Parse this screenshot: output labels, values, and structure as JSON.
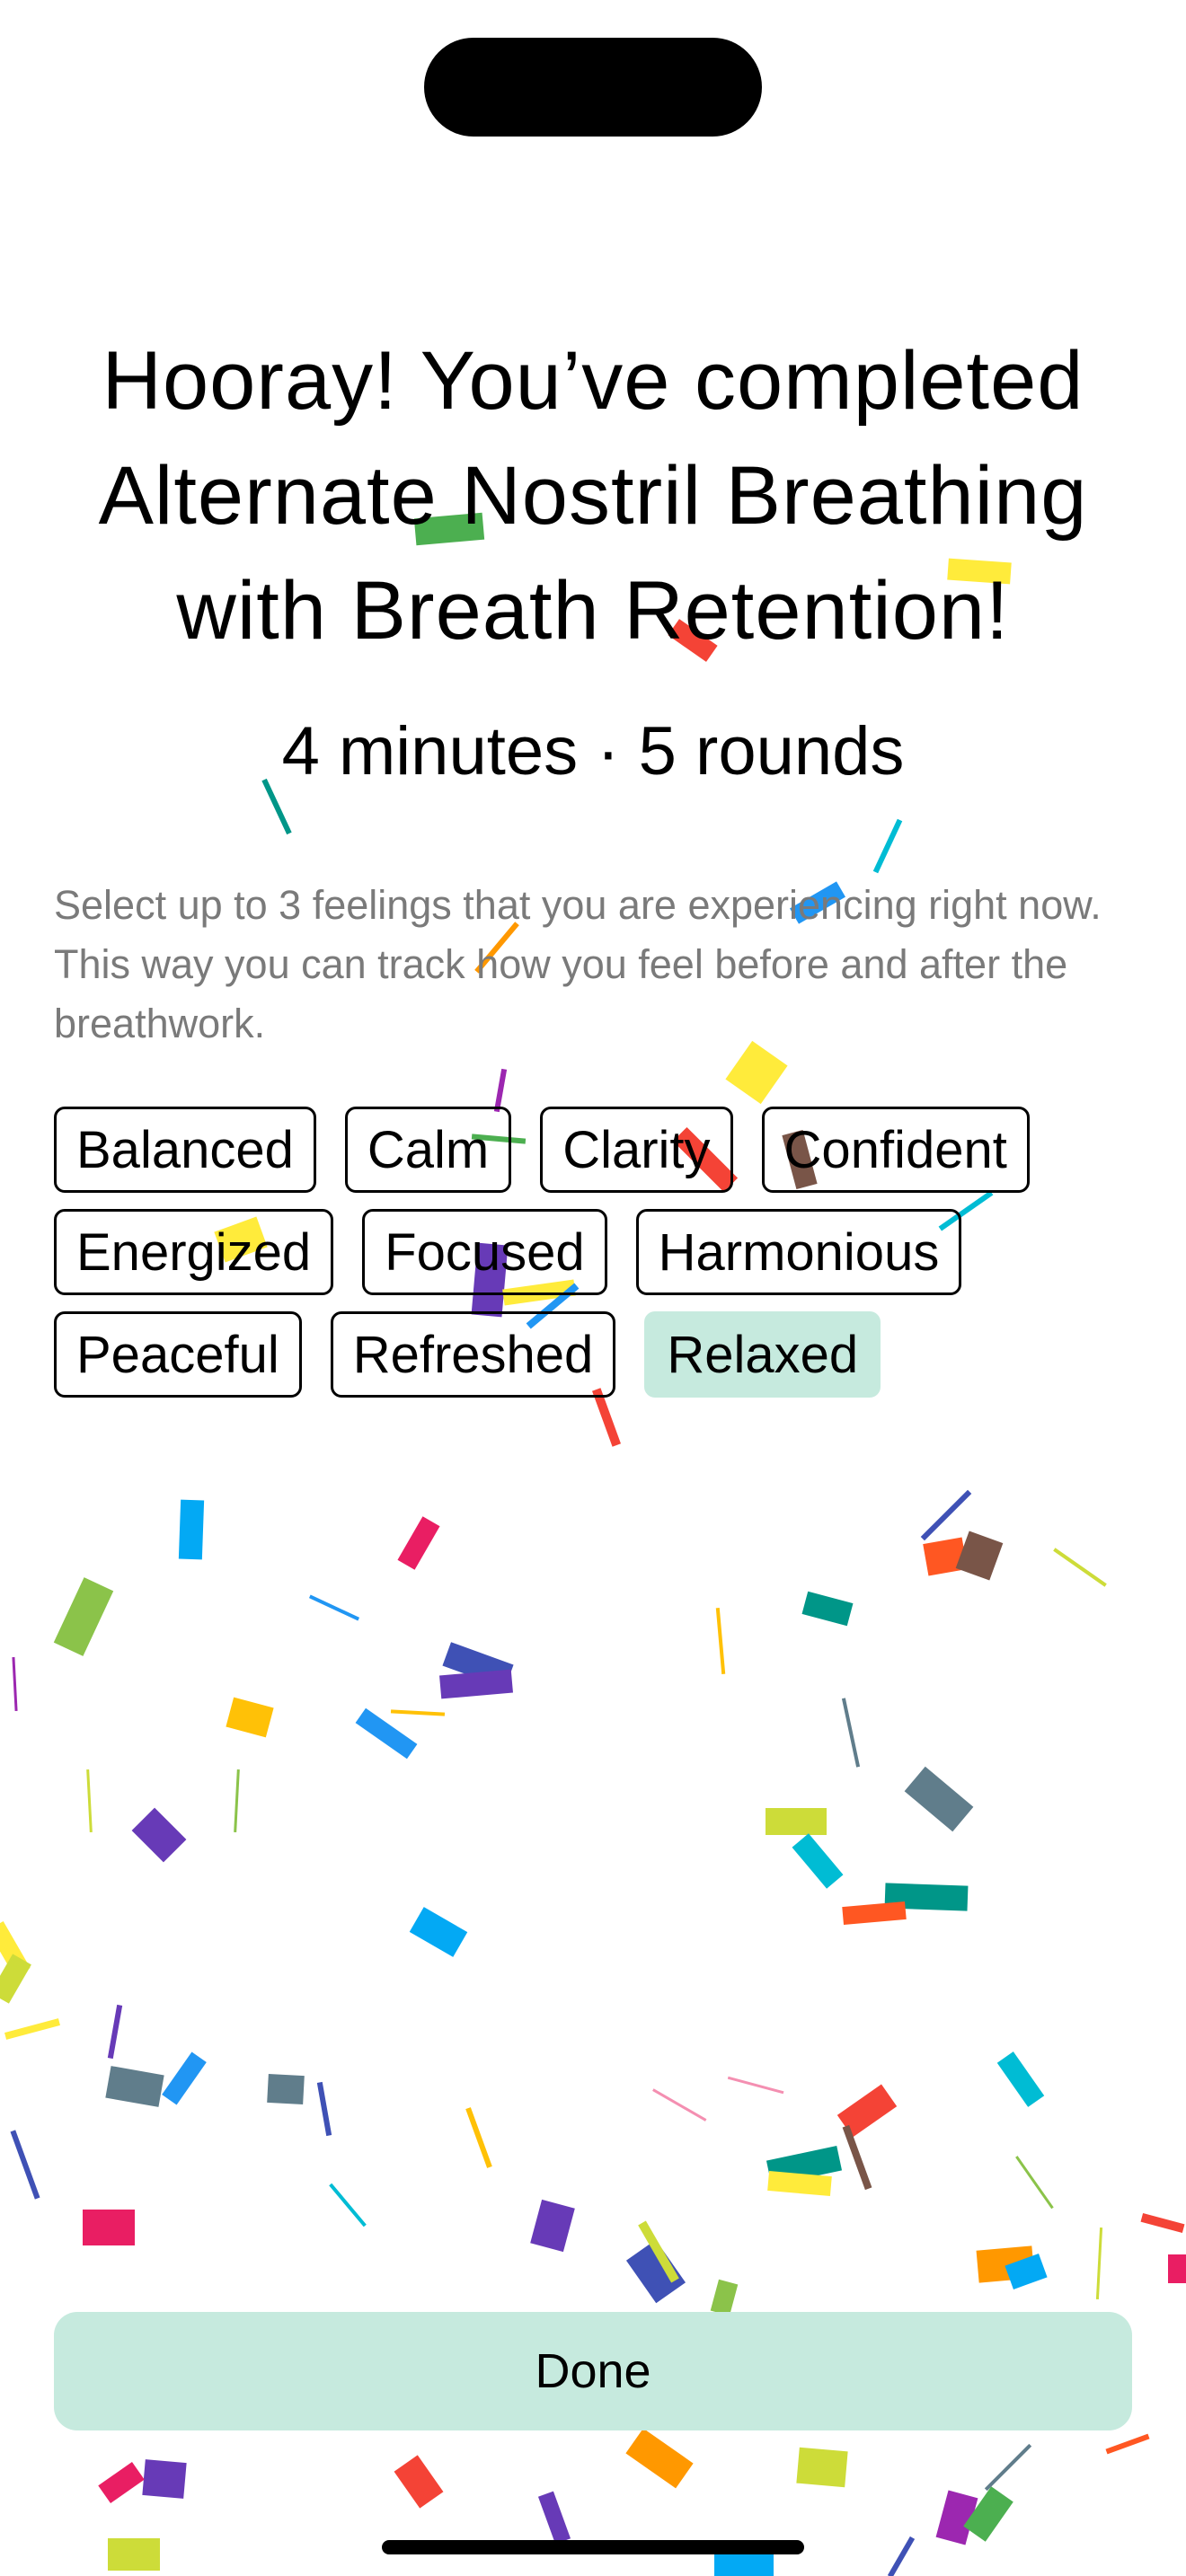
{
  "completion": {
    "title_lines": [
      "Hooray! You’ve completed",
      "Alternate Nostril Breathing",
      "with Breath Retention!"
    ],
    "summary": "4 minutes · 5 rounds"
  },
  "feelings": {
    "instructions": "Select up to 3 feelings that you are experiencing right now. This way you can track how you feel before and after the breathwork.",
    "rows": [
      [
        {
          "label": "Balanced",
          "selected": false
        },
        {
          "label": "Calm",
          "selected": false
        },
        {
          "label": "Clarity",
          "selected": false
        },
        {
          "label": "Confident",
          "selected": false
        }
      ],
      [
        {
          "label": "Energized",
          "selected": false
        },
        {
          "label": "Focused",
          "selected": false
        },
        {
          "label": "Harmonious",
          "selected": false
        }
      ],
      [
        {
          "label": "Peaceful",
          "selected": false
        },
        {
          "label": "Refreshed",
          "selected": false
        },
        {
          "label": "Relaxed",
          "selected": true
        }
      ]
    ],
    "selected_color": "#c6eade"
  },
  "actions": {
    "done_label": "Done"
  },
  "theme": {
    "accent": "#c6eade",
    "confetti_colors": [
      "#4caf50",
      "#ffeb3b",
      "#f44336",
      "#03a9f4",
      "#673ab7",
      "#009688",
      "#ff9800",
      "#795548",
      "#e91e63",
      "#8bc34a",
      "#607d8b",
      "#ffc107",
      "#cddc39",
      "#00bcd4",
      "#3f51b5",
      "#2196f3",
      "#9c27b0",
      "#ff5722"
    ]
  }
}
